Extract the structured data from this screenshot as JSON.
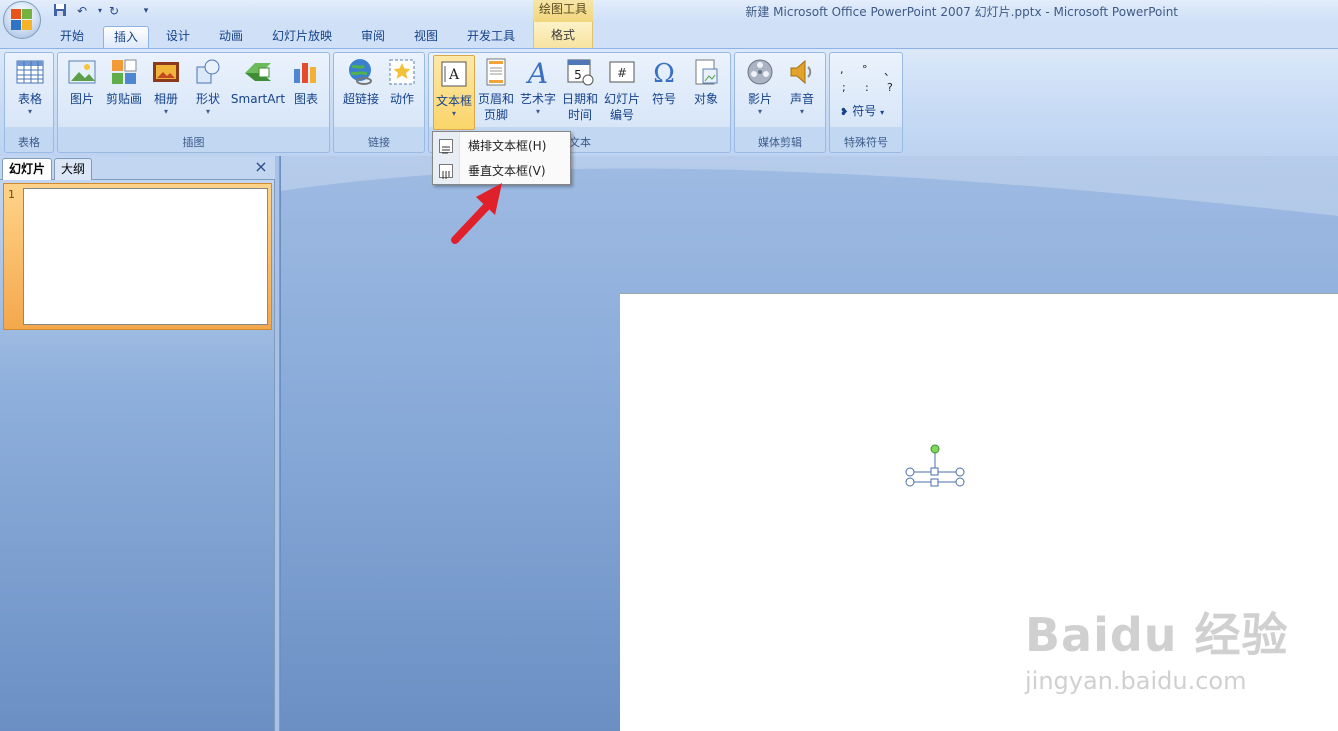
{
  "title_bar": {
    "window_title": "新建 Microsoft Office PowerPoint 2007 幻灯片.pptx - Microsoft PowerPoint",
    "context_tab_group": "绘图工具",
    "quick_access": [
      "save-icon",
      "undo-icon",
      "redo-icon",
      "customize-icon"
    ]
  },
  "tabs": [
    {
      "label": "开始"
    },
    {
      "label": "插入",
      "active": true
    },
    {
      "label": "设计"
    },
    {
      "label": "动画"
    },
    {
      "label": "幻灯片放映"
    },
    {
      "label": "审阅"
    },
    {
      "label": "视图"
    },
    {
      "label": "开发工具"
    },
    {
      "label": "格式",
      "context": true
    }
  ],
  "ribbon": {
    "groups": [
      {
        "label": "表格",
        "buttons": [
          {
            "label": "表格"
          }
        ]
      },
      {
        "label": "插图",
        "buttons": [
          {
            "label": "图片"
          },
          {
            "label": "剪贴画"
          },
          {
            "label": "相册"
          },
          {
            "label": "形状"
          },
          {
            "label": "SmartArt"
          },
          {
            "label": "图表"
          }
        ]
      },
      {
        "label": "链接",
        "buttons": [
          {
            "label": "超链接"
          },
          {
            "label": "动作"
          }
        ]
      },
      {
        "label": "文本",
        "buttons": [
          {
            "label": "文本框"
          },
          {
            "label": "页眉和",
            "label2": "页脚"
          },
          {
            "label": "艺术字"
          },
          {
            "label": "日期和",
            "label2": "时间"
          },
          {
            "label": "幻灯片",
            "label2": "编号"
          },
          {
            "label": "符号"
          },
          {
            "label": "对象"
          }
        ]
      },
      {
        "label": "媒体剪辑",
        "buttons": [
          {
            "label": "影片"
          },
          {
            "label": "声音"
          }
        ]
      },
      {
        "label": "特殊符号",
        "buttons": [
          {
            "label": "符号"
          }
        ]
      }
    ],
    "special_symbols": [
      ",",
      "°",
      "、",
      ";",
      ":",
      "?"
    ]
  },
  "dropdown": {
    "items": [
      {
        "label": "横排文本框(H)"
      },
      {
        "label": "垂直文本框(V)"
      }
    ]
  },
  "left_pane": {
    "tabs": [
      {
        "label": "幻灯片",
        "active": true
      },
      {
        "label": "大纲"
      }
    ],
    "close": "×",
    "slide_number": "1"
  },
  "watermark": {
    "main": "Baidu 经验",
    "sub": "jingyan.baidu.com"
  },
  "colors": {
    "ribbon_bg": "#c6daf4",
    "pressed_button": "#fbd56a",
    "thumbnail_selected": "#f4a84c",
    "arrow": "#e0202a"
  }
}
